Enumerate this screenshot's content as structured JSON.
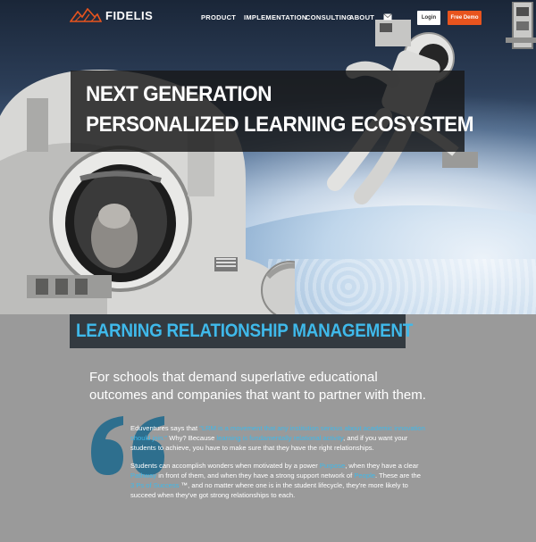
{
  "brand": {
    "name": "FIDELIS",
    "accent": "#e8541e",
    "highlight": "#3fb9ea"
  },
  "nav": {
    "links": [
      "PRODUCT",
      "IMPLEMENTATION",
      "CONSULTING",
      "ABOUT"
    ],
    "login_label": "Login",
    "demo_label": "Free Demo"
  },
  "hero": {
    "line1": "NEXT GENERATION",
    "line2": "PERSONALIZED LEARNING ECOSYSTEM"
  },
  "section": {
    "title": "LEARNING RELATIONSHIP MANAGEMENT",
    "tagline": "For schools that demand superlative educational outcomes and companies that want to partner with them.",
    "p1": {
      "a": "Eduventures says that ",
      "b": "\"LRM is a movement that any institution serious about academic innovation should join.\"",
      "c": " Why? Because ",
      "d": "learning is fundamentally relational activity",
      "e": ", and if you want your students to achieve, you have to make sure that they have the right relationships."
    },
    "p2": {
      "a": "Students can accomplish wonders when motivated by a power ",
      "b": "Purpose",
      "c": ", when they have a clear ",
      "d": "Pathway",
      "e": " in front of them, and when they have a strong support network of ",
      "f": "People",
      "g": ". These are the ",
      "h": "3 Ps of Success",
      "i": " ™, and no matter where one is in the student lifecycle, they're more likely to succeed when they've got strong relationships to each."
    }
  }
}
